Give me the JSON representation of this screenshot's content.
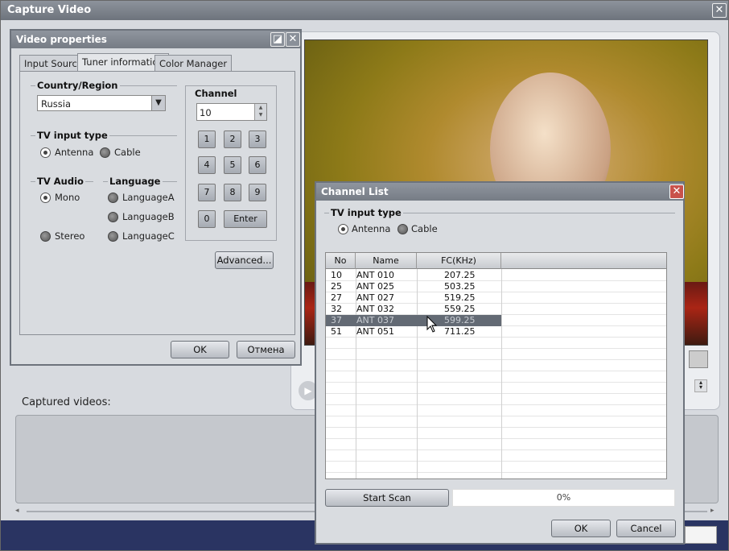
{
  "main": {
    "title": "Capture Video",
    "captured_label": "Captured videos:"
  },
  "video_props": {
    "title": "Video properties",
    "tabs": [
      {
        "label": "Input Source"
      },
      {
        "label": "Tuner information"
      },
      {
        "label": "Color Manager"
      }
    ],
    "country_label": "Country/Region",
    "country_value": "Russia",
    "tv_input_label": "TV input type",
    "tv_input_options": [
      "Antenna",
      "Cable"
    ],
    "tv_audio_label": "TV Audio",
    "audio_options": [
      "Mono",
      "Stereo"
    ],
    "language_label": "Language",
    "language_options": [
      "LanguageA",
      "LanguageB",
      "LanguageC"
    ],
    "channel_label": "Channel",
    "channel_value": "10",
    "keypad": [
      "1",
      "2",
      "3",
      "4",
      "5",
      "6",
      "7",
      "8",
      "9",
      "0"
    ],
    "enter_label": "Enter",
    "advanced_label": "Advanced...",
    "ok_label": "OK",
    "cancel_label": "Отмена"
  },
  "channel_list": {
    "title": "Channel List",
    "tv_input_label": "TV input type",
    "tv_input_options": [
      "Antenna",
      "Cable"
    ],
    "columns": [
      "No",
      "Name",
      "FC(KHz)"
    ],
    "rows": [
      {
        "no": "10",
        "name": "ANT 010",
        "fc": "207.25"
      },
      {
        "no": "25",
        "name": "ANT 025",
        "fc": "503.25"
      },
      {
        "no": "27",
        "name": "ANT 027",
        "fc": "519.25"
      },
      {
        "no": "32",
        "name": "ANT 032",
        "fc": "559.25"
      },
      {
        "no": "37",
        "name": "ANT 037",
        "fc": "599.25"
      },
      {
        "no": "51",
        "name": "ANT 051",
        "fc": "711.25"
      }
    ],
    "start_scan_label": "Start Scan",
    "progress_text": "0%",
    "ok_label": "OK",
    "cancel_label": "Cancel"
  }
}
